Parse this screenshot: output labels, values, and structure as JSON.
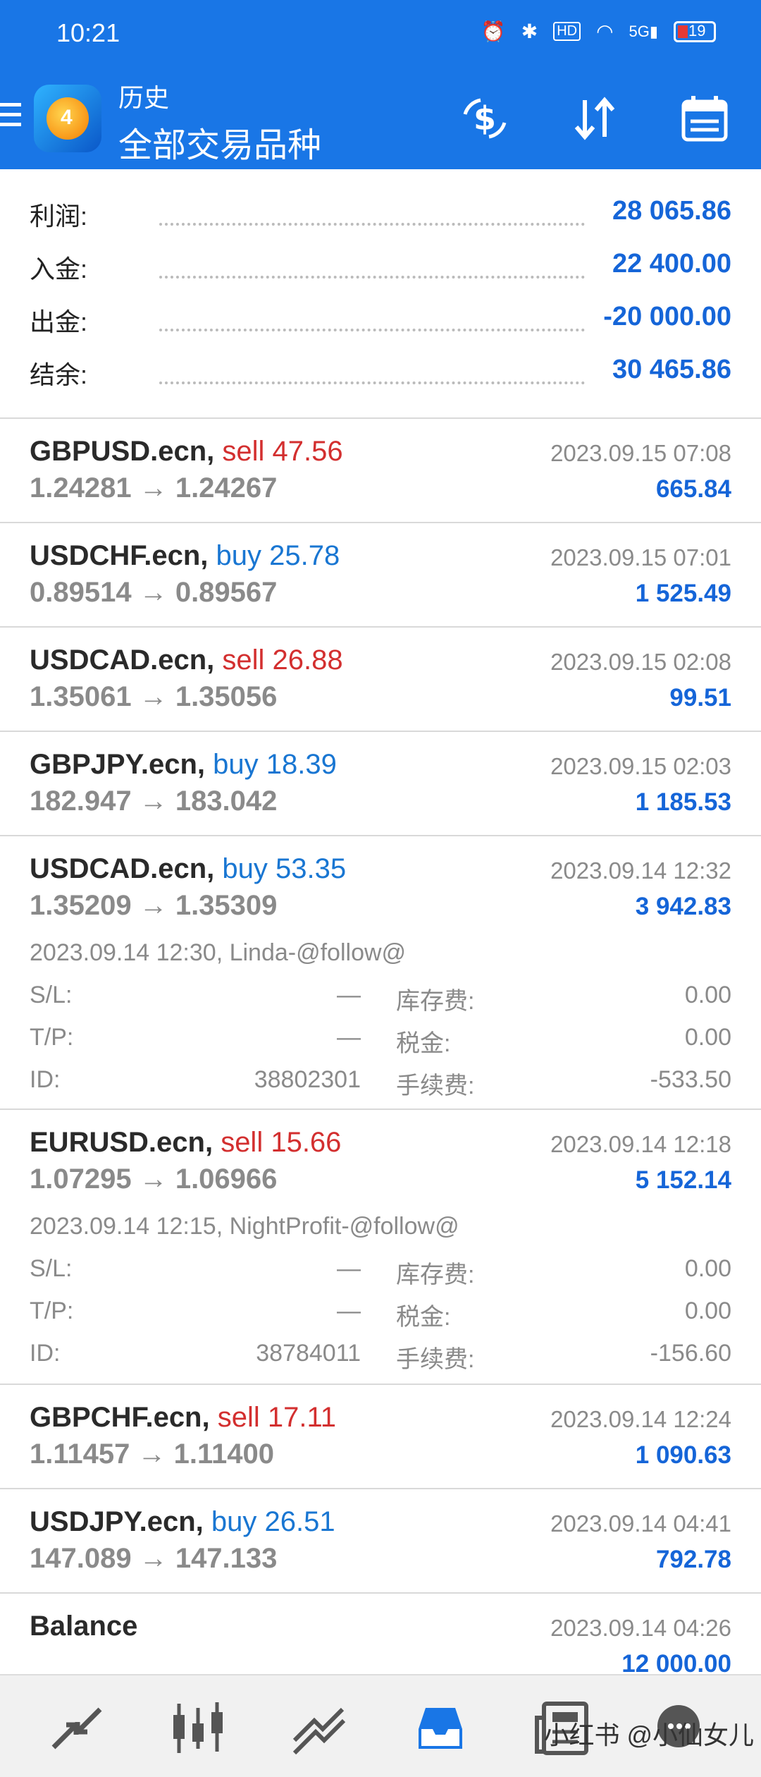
{
  "status_bar": {
    "time": "10:21",
    "battery": "19",
    "icons": [
      "alarm-icon",
      "bluetooth-icon",
      "hd-icon",
      "wifi-icon",
      "5g-signal-icon",
      "battery-icon"
    ]
  },
  "toolbar": {
    "title": "历史",
    "subtitle": "全部交易品种",
    "actions": [
      "currency-exchange-icon",
      "sort-icon",
      "calendar-icon"
    ],
    "logo_text": "4"
  },
  "summary": [
    {
      "label": "利润:",
      "value": "28 065.86"
    },
    {
      "label": "入金:",
      "value": "22 400.00"
    },
    {
      "label": "出金:",
      "value": "-20 000.00"
    },
    {
      "label": "结余:",
      "value": "30 465.86"
    }
  ],
  "trades": [
    {
      "symbol": "GBPUSD.ecn,",
      "side": "sell 47.56",
      "prices": "1.24281 → 1.24267",
      "time": "2023.09.15 07:08",
      "profit": "665.84"
    },
    {
      "symbol": "USDCHF.ecn,",
      "side": "buy 25.78",
      "prices": "0.89514 → 0.89567",
      "time": "2023.09.15 07:01",
      "profit": "1 525.49"
    },
    {
      "symbol": "USDCAD.ecn,",
      "side": "sell 26.88",
      "prices": "1.35061 → 1.35056",
      "time": "2023.09.15 02:08",
      "profit": "99.51"
    },
    {
      "symbol": "GBPJPY.ecn,",
      "side": "buy 18.39",
      "prices": "182.947 → 183.042",
      "time": "2023.09.15 02:03",
      "profit": "1 185.53"
    },
    {
      "symbol": "USDCAD.ecn,",
      "side": "buy 53.35",
      "prices": "1.35209 → 1.35309",
      "time": "2023.09.14 12:32",
      "profit": "3 942.83",
      "detail": {
        "open_line": "2023.09.14 12:30, Linda-@follow@",
        "sl_label": "S/L:",
        "sl": "—",
        "swap_label": "库存费:",
        "swap": "0.00",
        "tp_label": "T/P:",
        "tp": "—",
        "tax_label": "税金:",
        "tax": "0.00",
        "id_label": "ID:",
        "id": "38802301",
        "fee_label": "手续费:",
        "fee": "-533.50"
      }
    },
    {
      "symbol": "EURUSD.ecn,",
      "side": "sell 15.66",
      "prices": "1.07295 → 1.06966",
      "time": "2023.09.14 12:18",
      "profit": "5 152.14",
      "detail": {
        "open_line": "2023.09.14 12:15, NightProfit-@follow@",
        "sl_label": "S/L:",
        "sl": "—",
        "swap_label": "库存费:",
        "swap": "0.00",
        "tp_label": "T/P:",
        "tp": "—",
        "tax_label": "税金:",
        "tax": "0.00",
        "id_label": "ID:",
        "id": "38784011",
        "fee_label": "手续费:",
        "fee": "-156.60"
      }
    },
    {
      "symbol": "GBPCHF.ecn,",
      "side": "sell 17.11",
      "prices": "1.11457 → 1.11400",
      "time": "2023.09.14 12:24",
      "profit": "1 090.63"
    },
    {
      "symbol": "USDJPY.ecn,",
      "side": "buy 26.51",
      "prices": "147.089 → 147.133",
      "time": "2023.09.14 04:41",
      "profit": "792.78"
    }
  ],
  "balance_row": {
    "label": "Balance",
    "time": "2023.09.14 04:26",
    "amount": "12 000.00"
  },
  "bottom_nav": [
    "quotes-icon",
    "chart-icon",
    "trade-icon",
    "history-icon",
    "news-icon",
    "chat-icon"
  ],
  "watermark": "小红书 @小仙女儿",
  "colors": {
    "brand": "#1976e6",
    "profit_blue": "#1565d8",
    "sell_red": "#d32f2f",
    "buy_blue": "#1976d2"
  }
}
